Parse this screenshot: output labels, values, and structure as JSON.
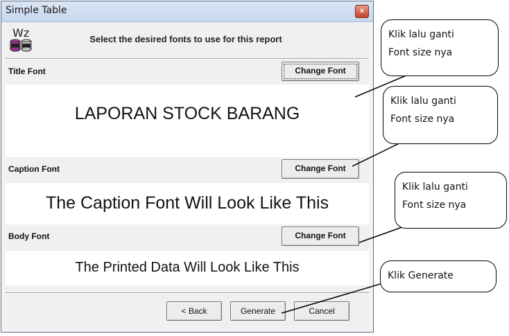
{
  "window": {
    "title": "Simple Table",
    "close_symbol": "×"
  },
  "header": {
    "logo_text": "Wz",
    "instructions": "Select the desired fonts to use for this report"
  },
  "sections": [
    {
      "label": "Title Font",
      "button": "Change Font",
      "preview": "LAPORAN STOCK BARANG"
    },
    {
      "label": "Caption Font",
      "button": "Change Font",
      "preview": "The Caption Font Will Look Like This"
    },
    {
      "label": "Body Font",
      "button": "Change Font",
      "preview": "The Printed Data Will Look Like This"
    }
  ],
  "footer": {
    "back": "< Back",
    "generate": "Generate",
    "cancel": "Cancel"
  },
  "annotations": [
    {
      "line1": "Klik lalu ganti",
      "line2": "Font size nya"
    },
    {
      "line1": "Klik lalu ganti",
      "line2": "Font size nya"
    },
    {
      "line1": "Klik lalu ganti",
      "line2": "Font size nya"
    },
    {
      "line1": "Klik Generate",
      "line2": ""
    }
  ]
}
